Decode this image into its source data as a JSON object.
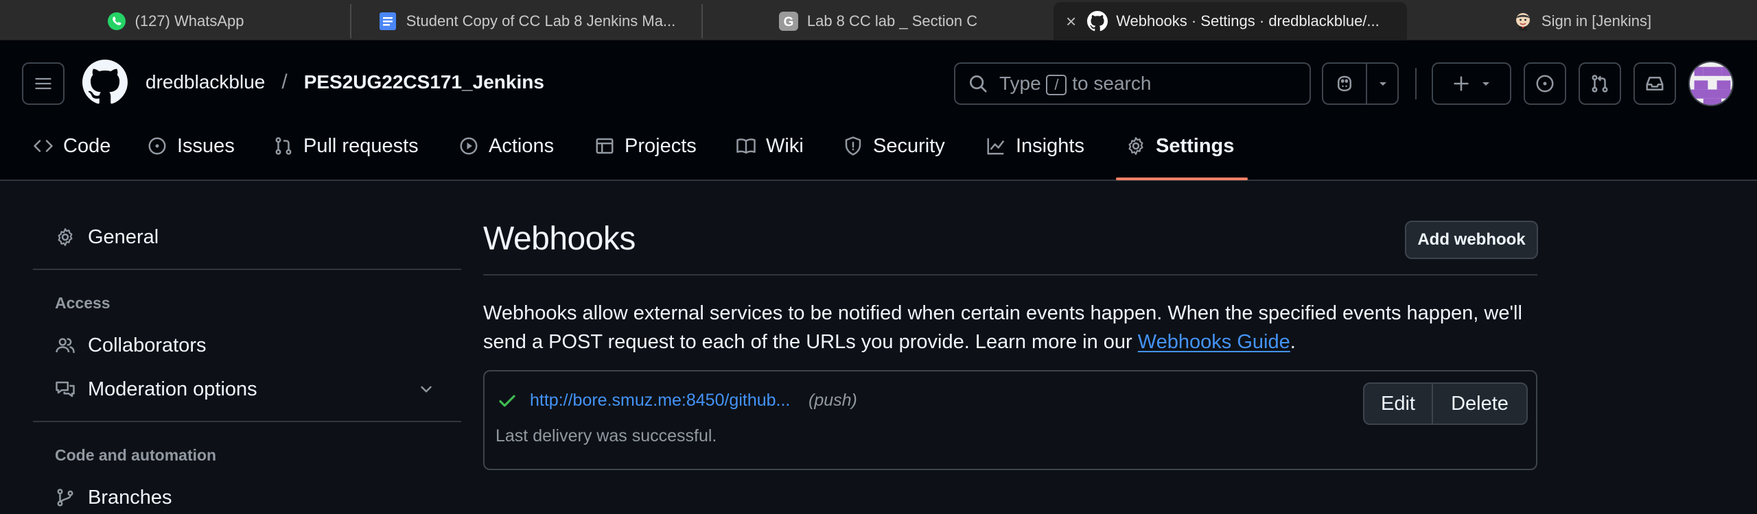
{
  "browser": {
    "tabs": [
      {
        "title": "(127) WhatsApp",
        "icon": "whatsapp-icon"
      },
      {
        "title": "Student Copy of CC Lab 8 Jenkins Ma...",
        "icon": "google-docs-icon"
      },
      {
        "title": "Lab 8 CC lab _ Section C",
        "icon": "g-icon"
      },
      {
        "title": "Webhooks · Settings · dredblackblue/...",
        "icon": "github-icon",
        "active": true
      },
      {
        "title": "Sign in [Jenkins]",
        "icon": "jenkins-icon"
      }
    ]
  },
  "header": {
    "owner": "dredblackblue",
    "separator": "/",
    "repo": "PES2UG22CS171_Jenkins",
    "search_prefix": "Type",
    "search_key": "/",
    "search_suffix": "to search"
  },
  "repo_nav": [
    {
      "label": "Code",
      "icon": "code-icon"
    },
    {
      "label": "Issues",
      "icon": "issue-opened-icon"
    },
    {
      "label": "Pull requests",
      "icon": "git-pull-request-icon"
    },
    {
      "label": "Actions",
      "icon": "play-icon"
    },
    {
      "label": "Projects",
      "icon": "table-icon"
    },
    {
      "label": "Wiki",
      "icon": "book-icon"
    },
    {
      "label": "Security",
      "icon": "shield-icon"
    },
    {
      "label": "Insights",
      "icon": "graph-icon"
    },
    {
      "label": "Settings",
      "icon": "gear-icon",
      "selected": true
    }
  ],
  "sidebar": {
    "general": "General",
    "access_heading": "Access",
    "collaborators": "Collaborators",
    "moderation": "Moderation options",
    "code_heading": "Code and automation",
    "branches": "Branches"
  },
  "main": {
    "title": "Webhooks",
    "add_button": "Add webhook",
    "description": "Webhooks allow external services to be notified when certain events happen. When the specified events happen, we'll send a POST request to each of the URLs you provide. Learn more in our ",
    "guide_link": "Webhooks Guide",
    "description_end": ".",
    "webhook": {
      "url": "http://bore.smuz.me:8450/github...",
      "events": "(push)",
      "status": "Last delivery was successful.",
      "edit_label": "Edit",
      "delete_label": "Delete"
    }
  },
  "colors": {
    "accent_link": "#4493f8",
    "success": "#3fb950",
    "selected_underline": "#f78166"
  }
}
